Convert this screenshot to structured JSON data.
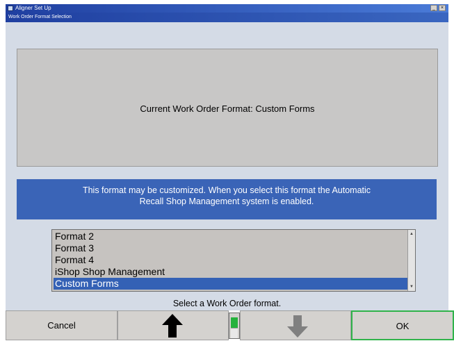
{
  "window": {
    "title": "Aligner Set Up",
    "minimize_glyph": "_",
    "close_glyph": "×"
  },
  "dialog": {
    "title": "Work Order Format Selection"
  },
  "current_format": {
    "text": "Current Work Order Format:  Custom Forms"
  },
  "info": {
    "line1": "This format may be customized.  When you select this format the Automatic",
    "line2": "Recall Shop Management system is enabled."
  },
  "format_list": {
    "items": [
      "Format 2",
      "Format 3",
      "Format 4",
      "iShop Shop Management",
      "Custom Forms"
    ],
    "selected_index": 4,
    "scroll_up_glyph": "▲",
    "scroll_down_glyph": "▼"
  },
  "prompt": "Select a Work Order format.",
  "buttons": {
    "cancel": "Cancel",
    "up": "up-arrow-icon",
    "down": "down-arrow-icon",
    "ok": "OK"
  },
  "indicator": {
    "level": 0.5
  },
  "colors": {
    "accent_blue": "#3a64b7",
    "selection_blue": "#3461b5",
    "ok_border_green": "#2fb34a"
  }
}
